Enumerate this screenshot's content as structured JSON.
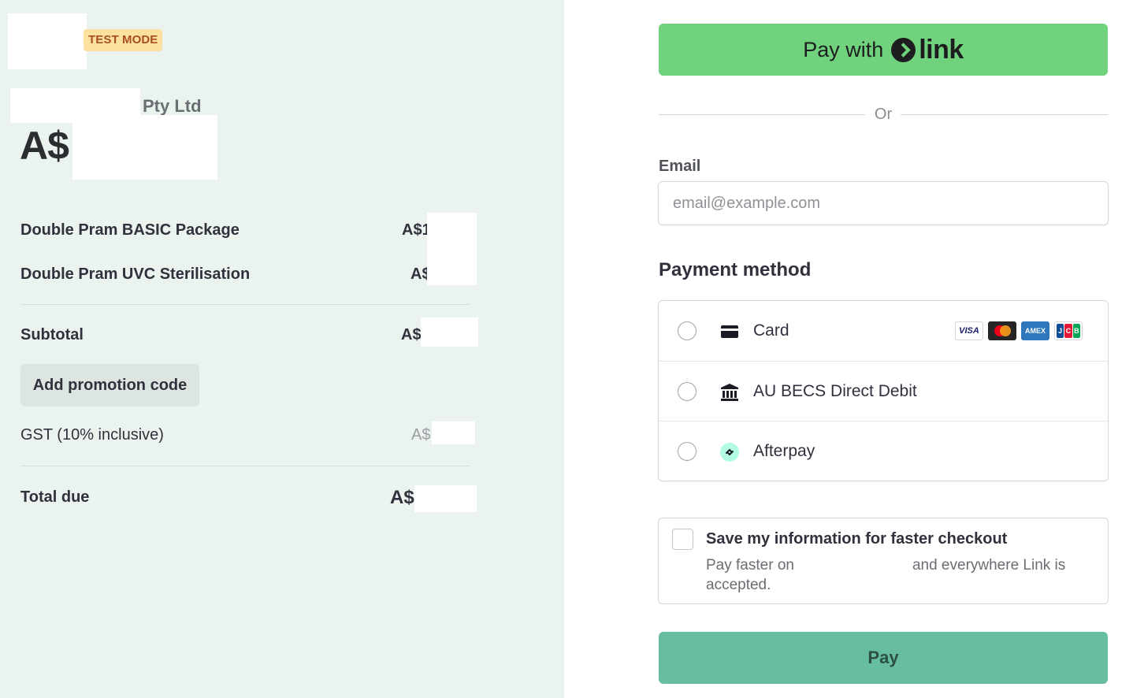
{
  "summary": {
    "test_mode_badge": "TEST MODE",
    "merchant_suffix": "Pty Ltd",
    "amount_currency": "A$",
    "line_items": [
      {
        "name": "Double Pram BASIC Package",
        "price": "A$1"
      },
      {
        "name": "Double Pram UVC Sterilisation",
        "price": "A$"
      }
    ],
    "subtotal_label": "Subtotal",
    "subtotal_price": "A$",
    "promo_label": "Add promotion code",
    "gst_label": "GST (10% inclusive)",
    "gst_price": "A$",
    "total_label": "Total due",
    "total_price": "A$"
  },
  "checkout": {
    "link_button_prefix": "Pay with",
    "link_button_brand": "link",
    "or_text": "Or",
    "email_label": "Email",
    "email_value": "",
    "email_placeholder": "email@example.com",
    "payment_method_title": "Payment method",
    "methods": [
      {
        "label": "Card",
        "icon": "card-icon"
      },
      {
        "label": "AU BECS Direct Debit",
        "icon": "bank-icon"
      },
      {
        "label": "Afterpay",
        "icon": "afterpay-icon"
      }
    ],
    "card_brands": [
      "VISA",
      "AMEX",
      "JCB"
    ],
    "save_title": "Save my information for faster checkout",
    "save_desc_start": "Pay faster on",
    "save_desc_end": "and everywhere Link is accepted.",
    "pay_label": "Pay"
  },
  "colors": {
    "left_background": "#ebf3ef",
    "link_green": "#71d27d",
    "pay_button": "#66be9e",
    "test_badge_bg": "#fbe0a0",
    "test_badge_text": "#a9501c"
  }
}
